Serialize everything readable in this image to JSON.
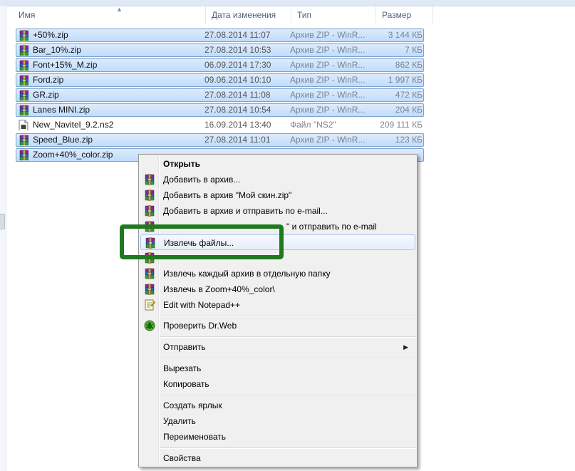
{
  "header": {
    "name": "Имя",
    "date": "Дата изменения",
    "type": "Тип",
    "size": "Размер"
  },
  "files": [
    {
      "name": "+50%.zip",
      "date": "27.08.2014 11:07",
      "type": "Архив ZIP - WinR...",
      "size": "3 144 КБ",
      "selected": true,
      "icon": "winrar-archive-icon"
    },
    {
      "name": "Bar_10%.zip",
      "date": "27.08.2014 10:53",
      "type": "Архив ZIP - WinR...",
      "size": "7 КБ",
      "selected": true,
      "icon": "winrar-archive-icon"
    },
    {
      "name": "Font+15%_M.zip",
      "date": "06.09.2014 17:30",
      "type": "Архив ZIP - WinR...",
      "size": "862 КБ",
      "selected": true,
      "icon": "winrar-archive-icon"
    },
    {
      "name": "Ford.zip",
      "date": "09.06.2014 10:10",
      "type": "Архив ZIP - WinR...",
      "size": "1 997 КБ",
      "selected": true,
      "icon": "winrar-archive-icon"
    },
    {
      "name": "GR.zip",
      "date": "27.08.2014 11:08",
      "type": "Архив ZIP - WinR...",
      "size": "472 КБ",
      "selected": true,
      "icon": "winrar-archive-icon"
    },
    {
      "name": "Lanes MINI.zip",
      "date": "27.08.2014 10:54",
      "type": "Архив ZIP - WinR...",
      "size": "204 КБ",
      "selected": true,
      "icon": "winrar-archive-icon"
    },
    {
      "name": "New_Navitel_9.2.ns2",
      "date": "16.09.2014 13:40",
      "type": "Файл \"NS2\"",
      "size": "209 111 КБ",
      "selected": false,
      "icon": "generic-file-icon"
    },
    {
      "name": "Speed_Blue.zip",
      "date": "27.08.2014 11:01",
      "type": "Архив ZIP - WinR...",
      "size": "123 КБ",
      "selected": true,
      "icon": "winrar-archive-icon"
    },
    {
      "name": "Zoom+40%_color.zip",
      "date": "",
      "type": "",
      "size": "",
      "selected": true,
      "icon": "winrar-archive-icon"
    }
  ],
  "context_menu": {
    "open": "Открыть",
    "add_archive": "Добавить в архив...",
    "add_named": "Добавить в архив \"Мой скин.zip\"",
    "add_email": "Добавить в архив и отправить по e-mail...",
    "add_named_email_tail": "\" и отправить по e-mail",
    "extract": "Извлечь файлы...",
    "extract_each": "Извлечь каждый архив в отдельную папку",
    "extract_to": "Извлечь в Zoom+40%_color\\",
    "notepad": "Edit with Notepad++",
    "drweb": "Проверить Dr.Web",
    "send_to": "Отправить",
    "cut": "Вырезать",
    "copy": "Копировать",
    "shortcut": "Создать ярлык",
    "delete": "Удалить",
    "rename": "Переименовать",
    "properties": "Свойства"
  },
  "colors": {
    "selection": "#c1dcfc",
    "highlight_box": "#1f7a1f",
    "menu_bg": "#f0f0f0"
  }
}
